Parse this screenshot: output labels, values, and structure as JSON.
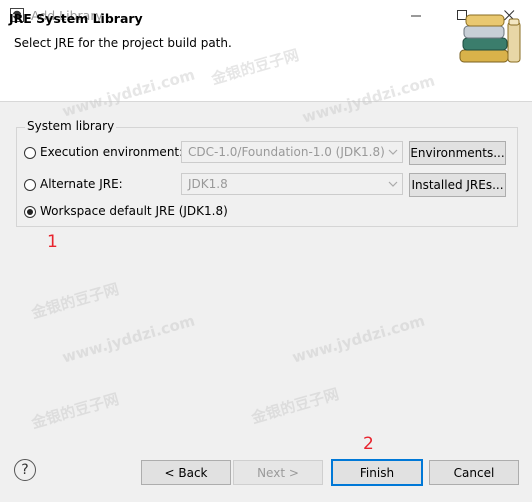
{
  "window": {
    "title": "Add Library",
    "minimize_icon": "minimize-icon",
    "maximize_icon": "maximize-icon",
    "close_icon": "close-icon"
  },
  "header": {
    "title": "JRE System Library",
    "subtitle": "Select JRE for the project build path.",
    "icon": "library-books-icon"
  },
  "group": {
    "label": "System library",
    "options": [
      {
        "label": "Execution environment:",
        "checked": false,
        "combo_value": "CDC-1.0/Foundation-1.0 (JDK1.8)",
        "button": "Environments..."
      },
      {
        "label": "Alternate JRE:",
        "checked": false,
        "combo_value": "JDK1.8",
        "button": "Installed JREs..."
      },
      {
        "label": "Workspace default JRE (JDK1.8)",
        "checked": true
      }
    ]
  },
  "annotations": {
    "one": "1",
    "two": "2"
  },
  "footer": {
    "help": "?",
    "back": "< Back",
    "next": "Next >",
    "finish": "Finish",
    "cancel": "Cancel"
  },
  "watermark": {
    "cn": "金银的豆子网",
    "url": "www.jyddzi.com"
  },
  "colors": {
    "accent": "#0078d7",
    "annotation": "#e8232d"
  }
}
